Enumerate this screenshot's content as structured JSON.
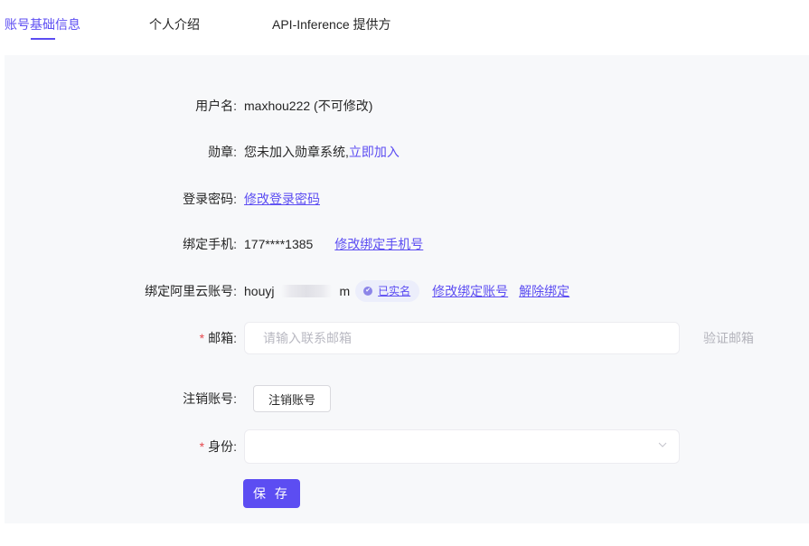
{
  "tabs": [
    {
      "label": "账号基础信息"
    },
    {
      "label": "个人介绍"
    },
    {
      "label": "API-Inference 提供方"
    }
  ],
  "form": {
    "username": {
      "label": "用户名:",
      "value": "maxhou222 (不可修改)"
    },
    "badge": {
      "label": "勋章:",
      "text": "您未加入勋章系统,",
      "link": "立即加入"
    },
    "password": {
      "label": "登录密码:",
      "link": "修改登录密码"
    },
    "phone": {
      "label": "绑定手机:",
      "value": "177****1385",
      "link": "修改绑定手机号"
    },
    "aliyun": {
      "label": "绑定阿里云账号:",
      "value_start": "houyj",
      "value_end": "m",
      "verified": "已实名",
      "modify_link": "修改绑定账号",
      "unbind_link": "解除绑定"
    },
    "email": {
      "required_mark": "*",
      "label": "邮箱:",
      "placeholder": "请输入联系邮箱",
      "verify": "验证邮箱"
    },
    "cancel": {
      "label": "注销账号:",
      "button": "注销账号"
    },
    "identity": {
      "required_mark": "*",
      "label": "身份:"
    },
    "save_button": "保 存"
  },
  "colors": {
    "accent": "#5c4df2",
    "required": "#e5484d",
    "panel_bg": "#f7f8fa"
  },
  "icons": {
    "verified": "check-circle-icon",
    "select": "chevron-down-icon"
  }
}
